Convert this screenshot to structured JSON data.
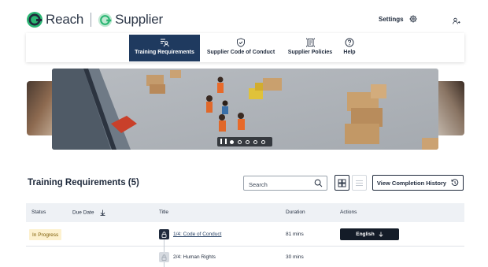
{
  "header": {
    "brand_primary": "Reach",
    "brand_secondary": "Supplier",
    "settings_label": "Settings",
    "settings_icon": "gear-icon",
    "user_icon": "user-icon"
  },
  "nav": {
    "tabs": [
      {
        "label": "Training Requirements",
        "icon": "training-icon",
        "active": true
      },
      {
        "label": "Supplier Code of Conduct",
        "icon": "shield-check-icon",
        "active": false
      },
      {
        "label": "Supplier Policies",
        "icon": "document-icon",
        "active": false
      },
      {
        "label": "Help",
        "icon": "question-icon",
        "active": false
      }
    ]
  },
  "carousel": {
    "slides": 5,
    "active_slide": 1,
    "pause_icon": "pause-icon"
  },
  "section": {
    "title": "Training Requirements (5)",
    "search_placeholder": "Search",
    "history_button": "View Completion History"
  },
  "table": {
    "headers": {
      "status": "Status",
      "due_date": "Due Date",
      "title": "Title",
      "duration": "Duration",
      "actions": "Actions"
    },
    "rows": [
      {
        "status": "In Progress",
        "title": "1/4: Code of Conduct",
        "duration": "81 mins",
        "action": "English",
        "locked": false
      },
      {
        "status": "",
        "title": "2/4: Human Rights",
        "duration": "30 mins",
        "action": "",
        "locked": true
      }
    ]
  },
  "colors": {
    "brand_green": "#2bb673",
    "navy": "#1f3a5f",
    "badge_bg": "#fdf1cf"
  }
}
